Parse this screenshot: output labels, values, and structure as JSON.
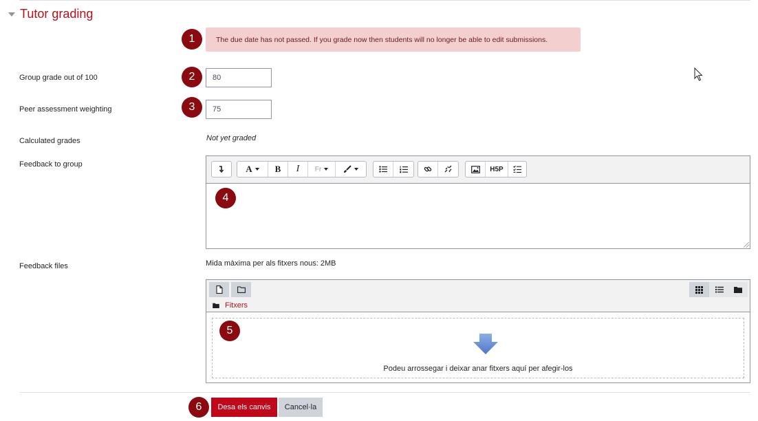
{
  "section": {
    "title": "Tutor grading"
  },
  "alert": {
    "text": "The due date has not passed. If you grade now then students will no longer be able to edit submissions."
  },
  "badges": [
    "1",
    "2",
    "3",
    "4",
    "5",
    "6"
  ],
  "fields": {
    "group_grade": {
      "label": "Group grade out of 100",
      "value": "80"
    },
    "peer_weighting": {
      "label": "Peer assessment weighting",
      "value": "75"
    },
    "calculated": {
      "label": "Calculated grades",
      "value": "Not yet graded"
    },
    "feedback": {
      "label": "Feedback to group"
    },
    "files": {
      "label": "Feedback files",
      "max_size": "Mida màxima per als fitxers nous: 2MB"
    }
  },
  "toolbar": {
    "bold": "B",
    "italic": "I",
    "lang": "Fr",
    "h5p": "H5P"
  },
  "filepicker": {
    "path": "Fitxers",
    "drop_text": "Podeu arrossegar i deixar anar fitxers aquí per afegir-los"
  },
  "buttons": {
    "save": "Desa els canvis",
    "cancel": "Cancel·la"
  },
  "colors": {
    "accent": "#b41019",
    "badge": "#8b0a0f",
    "alert_bg": "#f4cfcf",
    "primary_button": "#c1061a"
  }
}
